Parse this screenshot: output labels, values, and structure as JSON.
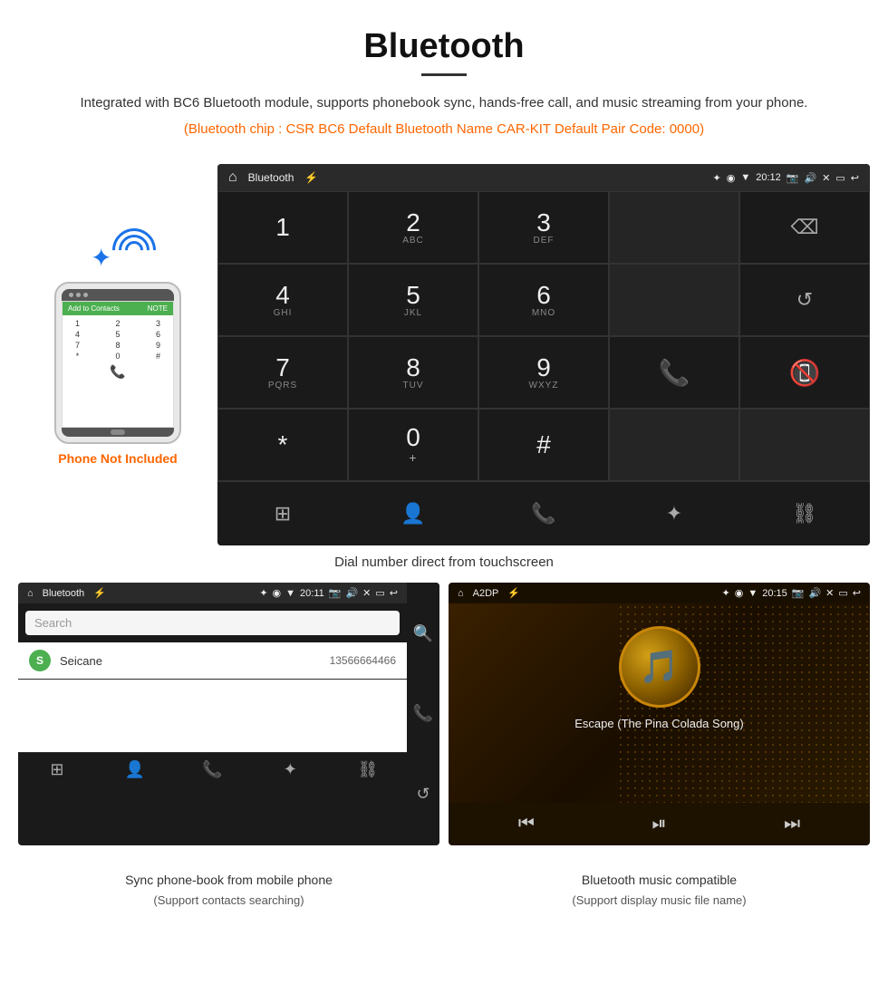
{
  "header": {
    "title": "Bluetooth",
    "description": "Integrated with BC6 Bluetooth module, supports phonebook sync, hands-free call, and music streaming from your phone.",
    "specs": "(Bluetooth chip : CSR BC6    Default Bluetooth Name CAR-KIT    Default Pair Code: 0000)"
  },
  "statusbar": {
    "bluetooth_label": "Bluetooth",
    "a2dp_label": "A2DP",
    "time1": "20:12",
    "time2": "20:11",
    "time3": "20:15",
    "usb_icon": "⚡"
  },
  "dialpad": {
    "keys": [
      {
        "number": "1",
        "sub": ""
      },
      {
        "number": "2",
        "sub": "ABC"
      },
      {
        "number": "3",
        "sub": "DEF"
      },
      {
        "number": "",
        "sub": ""
      },
      {
        "number": "⌫",
        "sub": ""
      },
      {
        "number": "4",
        "sub": "GHI"
      },
      {
        "number": "5",
        "sub": "JKL"
      },
      {
        "number": "6",
        "sub": "MNO"
      },
      {
        "number": "",
        "sub": ""
      },
      {
        "number": "↺",
        "sub": ""
      },
      {
        "number": "7",
        "sub": "PQRS"
      },
      {
        "number": "8",
        "sub": "TUV"
      },
      {
        "number": "9",
        "sub": "WXYZ"
      },
      {
        "number": "📞",
        "sub": ""
      },
      {
        "number": "📵",
        "sub": ""
      },
      {
        "number": "*",
        "sub": ""
      },
      {
        "number": "0",
        "sub": "+"
      },
      {
        "number": "#",
        "sub": ""
      },
      {
        "number": "",
        "sub": ""
      },
      {
        "number": "",
        "sub": ""
      }
    ],
    "toolbar": [
      "⊞",
      "👤",
      "📞",
      "✦",
      "⛓"
    ]
  },
  "phonebook": {
    "search_placeholder": "Search",
    "contact_name": "Seicane",
    "contact_number": "13566664466",
    "contact_letter": "S"
  },
  "music": {
    "song_title": "Escape (The Pina Colada Song)",
    "album_icon": "🎵"
  },
  "phone_label": "Phone Not Included",
  "captions": {
    "dial_caption": "Dial number direct from touchscreen",
    "phonebook_caption": "Sync phone-book from mobile phone",
    "phonebook_sub": "(Support contacts searching)",
    "music_caption": "Bluetooth music compatible",
    "music_sub": "(Support display music file name)"
  }
}
